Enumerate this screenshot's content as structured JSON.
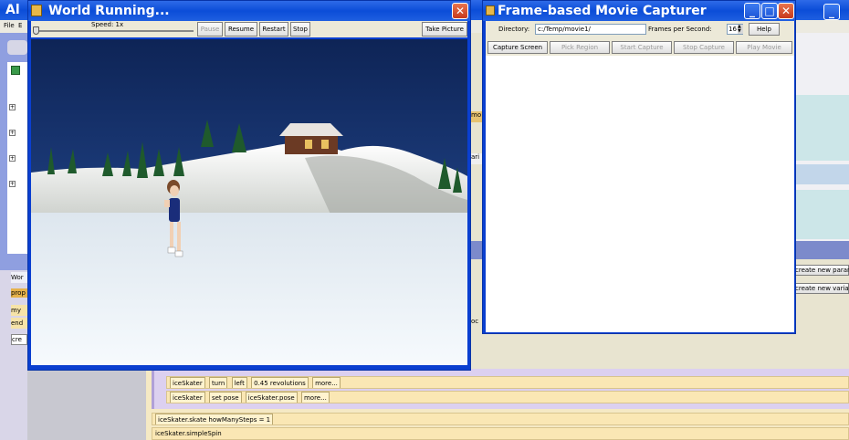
{
  "alice": {
    "title_fragment": "Al",
    "menu": [
      "File",
      "E"
    ],
    "world_tab": "Wor",
    "prop_tab": "prop",
    "list_items": [
      "my",
      "end"
    ],
    "create_item": "cre",
    "create_new_param": "create new param",
    "create_new_var": "create new varial",
    "method_tiles": {
      "turn": {
        "object": "iceSkater",
        "verb": "turn",
        "direction": "left",
        "amount": "0.45 revolutions",
        "more": "more..."
      },
      "setpose": {
        "object": "iceSkater",
        "verb": "set pose",
        "pose": "iceSkater.pose",
        "more": "more..."
      },
      "skate": {
        "object": "iceSkater",
        "text": "iceSkater.skate howManySteps = 1"
      },
      "spin": {
        "text": "iceSkater.simpleSpin"
      }
    },
    "side_frag_1": "mo",
    "side_frag_2": "ari",
    "side_frag_3": "oc"
  },
  "world_window": {
    "title": "World Running...",
    "speed_label": "Speed: 1x",
    "buttons": {
      "pause": "Pause",
      "resume": "Resume",
      "restart": "Restart",
      "stop": "Stop",
      "take_picture": "Take Picture"
    }
  },
  "capture_window": {
    "title": "Frame-based Movie Capturer",
    "directory_label": "Directory:",
    "directory_value": "c:/Temp/movie1/",
    "fps_label": "Frames per Second:",
    "fps_value": "16",
    "help": "Help",
    "buttons": {
      "capture": "Capture Screen",
      "pick": "Pick Region",
      "start": "Start Capture",
      "stop": "Stop Capture",
      "play": "Play Movie"
    }
  }
}
